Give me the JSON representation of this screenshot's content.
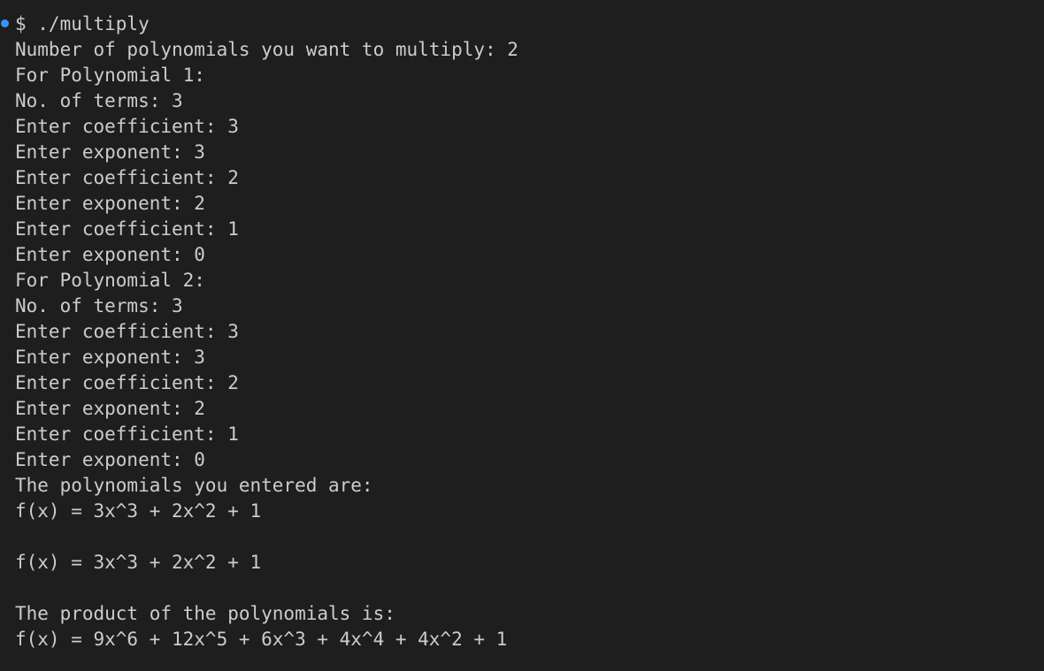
{
  "terminal": {
    "accent_color": "#3794ff",
    "lines": [
      "$ ./multiply",
      "Number of polynomials you want to multiply: 2",
      "For Polynomial 1:",
      "No. of terms: 3",
      "Enter coefficient: 3",
      "Enter exponent: 3",
      "Enter coefficient: 2",
      "Enter exponent: 2",
      "Enter coefficient: 1",
      "Enter exponent: 0",
      "For Polynomial 2:",
      "No. of terms: 3",
      "Enter coefficient: 3",
      "Enter exponent: 3",
      "Enter coefficient: 2",
      "Enter exponent: 2",
      "Enter coefficient: 1",
      "Enter exponent: 0",
      "The polynomials you entered are:",
      "f(x) = 3x^3 + 2x^2 + 1",
      "",
      "f(x) = 3x^3 + 2x^2 + 1",
      "",
      "The product of the polynomials is:",
      "f(x) = 9x^6 + 12x^5 + 6x^3 + 4x^4 + 4x^2 + 1"
    ]
  }
}
